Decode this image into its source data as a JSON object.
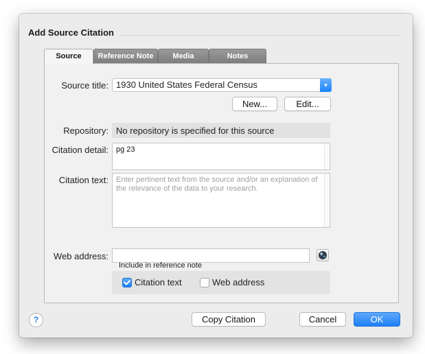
{
  "dialog": {
    "title": "Add Source Citation"
  },
  "tabs": [
    {
      "label": "Source",
      "active": true
    },
    {
      "label": "Reference Note",
      "active": false
    },
    {
      "label": "Media",
      "active": false
    },
    {
      "label": "Notes",
      "active": false
    }
  ],
  "form": {
    "source_title_label": "Source title:",
    "source_title_value": "1930 United States Federal Census",
    "new_button": "New...",
    "edit_button": "Edit...",
    "repository_label": "Repository:",
    "repository_value": "No repository is specified for this source",
    "citation_detail_label": "Citation detail:",
    "citation_detail_value": "pg 23",
    "citation_text_label": "Citation text:",
    "citation_text_placeholder": "Enter pertinent text from the source and/or an explanation of the relevance of the data to your research.",
    "web_address_label": "Web address:",
    "web_address_value": ""
  },
  "include": {
    "title": "Include in reference note",
    "citation_text": {
      "label": "Citation text",
      "checked": true
    },
    "web_address": {
      "label": "Web address",
      "checked": false
    }
  },
  "footer": {
    "help_label": "?",
    "copy_citation": "Copy Citation",
    "cancel": "Cancel",
    "ok": "OK"
  },
  "colors": {
    "accent": "#1d7ff6",
    "dialog_bg": "#ececec",
    "panel_bg": "#f1f1f1"
  },
  "icons": {
    "dropdown": "chevron-down-icon",
    "web": "globe-icon",
    "help": "help-icon"
  }
}
